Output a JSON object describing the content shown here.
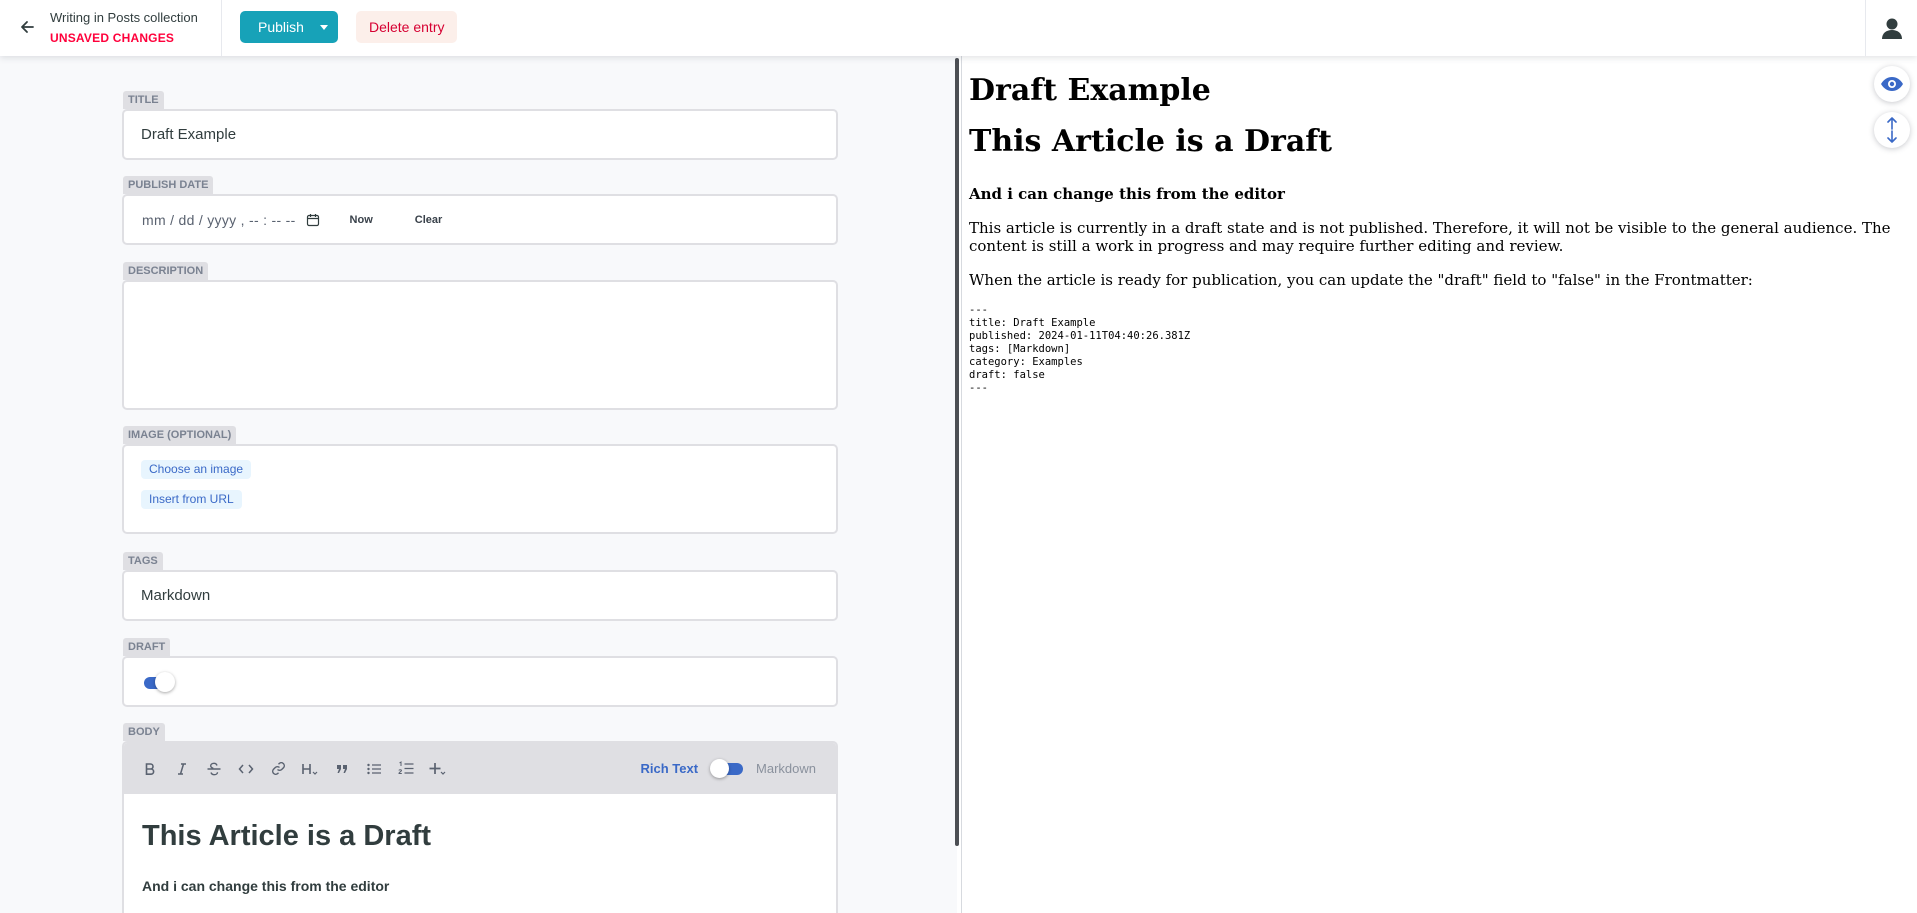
{
  "header": {
    "collection_title": "Writing in Posts collection",
    "status": "UNSAVED CHANGES",
    "publish_label": "Publish",
    "delete_label": "Delete entry"
  },
  "fields": {
    "title": {
      "label": "TITLE",
      "value": "Draft Example"
    },
    "publish_date": {
      "label": "PUBLISH DATE",
      "placeholder": "mm / dd / yyyy ,  -- : --   --",
      "now_label": "Now",
      "clear_label": "Clear"
    },
    "description": {
      "label": "DESCRIPTION",
      "value": ""
    },
    "image": {
      "label": "IMAGE (OPTIONAL)",
      "choose_label": "Choose an image",
      "url_label": "Insert from URL"
    },
    "tags": {
      "label": "TAGS",
      "value": "Markdown"
    },
    "draft": {
      "label": "DRAFT",
      "enabled": true
    },
    "body": {
      "label": "BODY",
      "mode_rich": "Rich Text",
      "mode_markdown": "Markdown",
      "heading": "This Article is a Draft",
      "subtext": "And i can change this from the editor"
    }
  },
  "preview": {
    "title": "Draft Example",
    "heading": "This Article is a Draft",
    "subheading": "And i can change this from the editor",
    "para1": "This article is currently in a draft state and is not published. Therefore, it will not be visible to the general audience. The content is still a work in progress and may require further editing and review.",
    "para2": "When the article is ready for publication, you can update the \"draft\" field to \"false\" in the Frontmatter:",
    "code": "---\ntitle: Draft Example\npublished: 2024-01-11T04:40:26.381Z\ntags: [Markdown]\ncategory: Examples\ndraft: false\n---"
  },
  "colors": {
    "accent": "#17a2b8",
    "danger": "#ff003b",
    "link": "#3a69c7"
  },
  "icons": [
    "arrow-left-icon",
    "caret-down-icon",
    "user-icon",
    "calendar-icon",
    "bold-icon",
    "italic-icon",
    "strikethrough-icon",
    "code-icon",
    "link-icon",
    "heading-icon",
    "quote-icon",
    "bulleted-list-icon",
    "numbered-list-icon",
    "add-component-icon",
    "eye-icon",
    "sync-scroll-icon"
  ]
}
